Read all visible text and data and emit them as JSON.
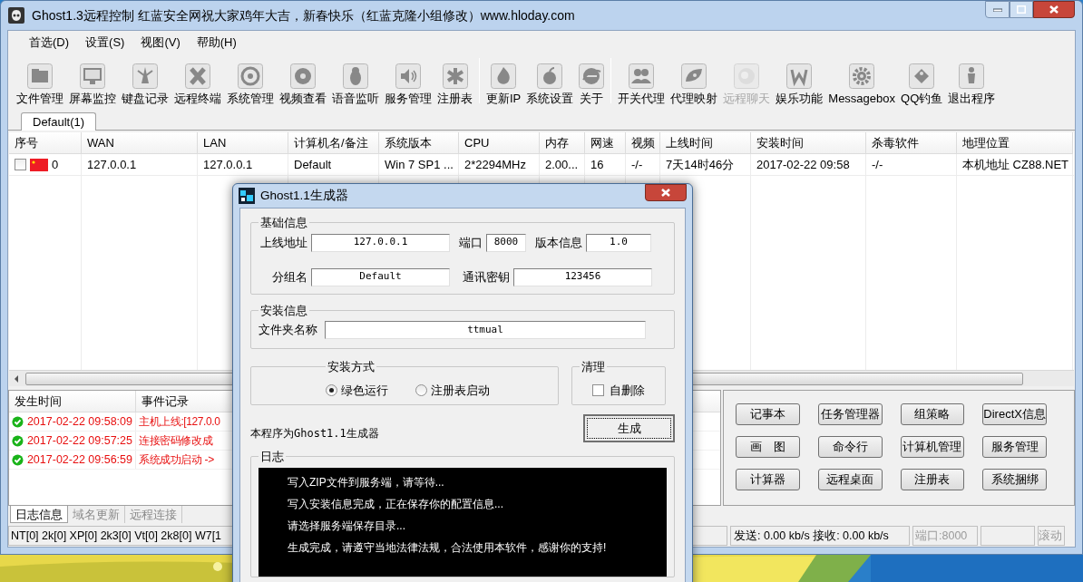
{
  "window": {
    "title": "Ghost1.3远程控制 红蓝安全网祝大家鸡年大吉，新春快乐（红蓝克隆小组修改）www.hloday.com"
  },
  "menu": [
    "首选(D)",
    "设置(S)",
    "视图(V)",
    "帮助(H)"
  ],
  "toolbar": [
    [
      {
        "label": "文件管理",
        "disabled": false
      },
      {
        "label": "屏幕监控",
        "disabled": false
      },
      {
        "label": "键盘记录",
        "disabled": false
      },
      {
        "label": "远程终端",
        "disabled": false
      },
      {
        "label": "系统管理",
        "disabled": false
      },
      {
        "label": "视频查看",
        "disabled": false
      },
      {
        "label": "语音监听",
        "disabled": false
      },
      {
        "label": "服务管理",
        "disabled": false
      },
      {
        "label": "注册表",
        "disabled": false
      }
    ],
    [
      {
        "label": "更新IP",
        "disabled": false
      },
      {
        "label": "系统设置",
        "disabled": false
      },
      {
        "label": "关于",
        "disabled": false
      }
    ],
    [
      {
        "label": "开关代理",
        "disabled": false
      },
      {
        "label": "代理映射",
        "disabled": false
      },
      {
        "label": "远程聊天",
        "disabled": true
      },
      {
        "label": "娱乐功能",
        "disabled": false
      },
      {
        "label": "Messagebox",
        "disabled": false
      },
      {
        "label": "QQ钓鱼",
        "disabled": false
      },
      {
        "label": "退出程序",
        "disabled": false
      }
    ]
  ],
  "tabs": [
    {
      "label": "Default(1)",
      "selected": true
    }
  ],
  "table": {
    "columns": [
      "序号",
      "WAN",
      "LAN",
      "计算机名/备注",
      "系统版本",
      "CPU",
      "内存",
      "网速",
      "视频",
      "上线时间",
      "安装时间",
      "杀毒软件",
      "地理位置"
    ],
    "rows": [
      {
        "checked": false,
        "cells": [
          "0",
          "127.0.0.1",
          "127.0.0.1",
          "Default",
          "Win 7 SP1 ...",
          "2*2294MHz",
          "2.00...",
          "16",
          "-/-",
          "7天14时46分",
          "2017-02-22 09:58",
          "-/-",
          "本机地址  CZ88.NET"
        ]
      }
    ]
  },
  "log": {
    "columns": [
      "发生时间",
      "事件记录"
    ],
    "rows": [
      {
        "time": "2017-02-22 09:58:09",
        "event": "主机上线:[127.0.0"
      },
      {
        "time": "2017-02-22 09:57:25",
        "event": "连接密码修改成"
      },
      {
        "time": "2017-02-22 09:56:59",
        "event": "系统成功启动 ->"
      }
    ]
  },
  "bottom_tabs": [
    {
      "label": "日志信息",
      "selected": true
    },
    {
      "label": "域名更新",
      "selected": false
    },
    {
      "label": "远程连接",
      "selected": false
    }
  ],
  "quick_buttons": [
    "记事本",
    "任务管理器",
    "组策略",
    "DirectX信息",
    "画　图",
    "命令行",
    "计算机管理",
    "服务管理",
    "计算器",
    "远程桌面",
    "注册表",
    "系统捆绑"
  ],
  "status_bar": {
    "systems": "NT[0] 2k[0] XP[0] 2k3[0] Vt[0] 2k8[0] W7[1",
    "traffic": "发送: 0.00 kb/s 接收: 0.00 kb/s",
    "port": "端口:8000",
    "scroll": "滚动"
  },
  "dialog": {
    "title": "Ghost1.1生成器",
    "basic": {
      "title": "基础信息",
      "address_label": "上线地址",
      "address": "127.0.0.1",
      "port_label": "端口",
      "port": "8000",
      "version_label": "版本信息",
      "version": "1.0",
      "group_label": "分组名",
      "group": "Default",
      "key_label": "通讯密钥",
      "key": "123456"
    },
    "install": {
      "title": "安装信息",
      "folder_label": "文件夹名称",
      "folder": "ttmual"
    },
    "mode": {
      "title": "安装方式",
      "options": [
        {
          "label": "绿色运行",
          "selected": true
        },
        {
          "label": "注册表启动",
          "selected": false
        }
      ]
    },
    "cleanup": {
      "title": "清理",
      "label": "自删除",
      "checked": false
    },
    "note": "本程序为Ghost1.1生成器",
    "generate_button": "生成",
    "log": {
      "title": "日志",
      "lines": [
        "写入ZIP文件到服务端，请等待...",
        "写入安装信息完成，正在保存你的配置信息...",
        "请选择服务端保存目录...",
        "生成完成，请遵守当地法律法规，合法使用本软件，感谢你的支持!"
      ]
    }
  }
}
